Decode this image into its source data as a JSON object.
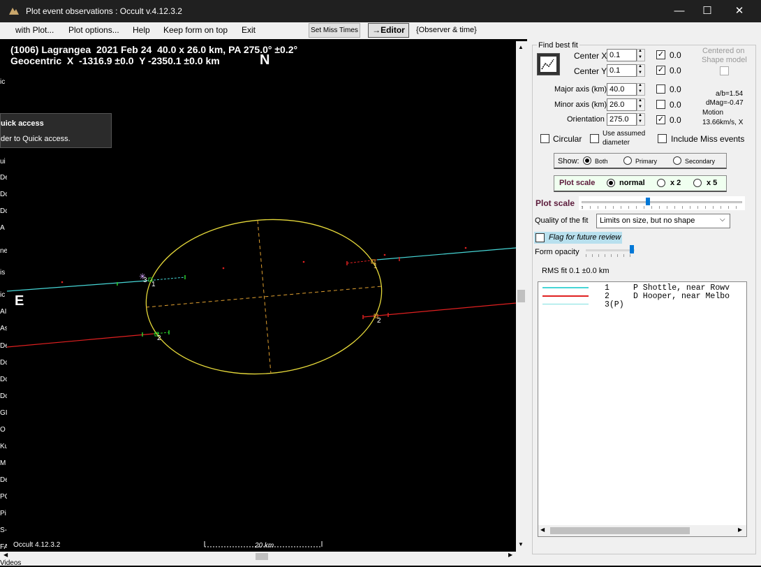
{
  "window": {
    "title": "Plot event observations : Occult v.4.12.3.2",
    "minimize_glyph": "—",
    "maximize_glyph": "☐",
    "close_glyph": "✕"
  },
  "menu": {
    "items": [
      "with Plot...",
      "Plot options...",
      "Help",
      "Keep form on top",
      "Exit"
    ],
    "set_miss_times": "Set Miss Times",
    "editor": "→Editor",
    "observer_time": "{Observer & time}"
  },
  "plot": {
    "header_line1": "(1006) Lagrangea  2021 Feb 24  40.0 x 26.0 km, PA 275.0° ±0.2°",
    "header_line2": "Geocentric  X  -1316.9 ±0.0  Y -2350.1 ±0.0 km",
    "north": "N",
    "east": "E",
    "footer": "Occult 4.12.3.2",
    "scale_label": "20 km",
    "chord_labels": [
      "1",
      "2",
      "3",
      "1",
      "2"
    ],
    "colors": {
      "ellipse": "#e6d93a",
      "chord1": "#46d6d6",
      "chord2": "#e02020",
      "axes": "#e0a030"
    }
  },
  "overlay": {
    "line1": "uick access",
    "line2": "der to Quick access."
  },
  "left_edge_fragments": [
    "ic",
    "ui",
    "De",
    "Dc",
    "Dc",
    "A",
    "ne",
    "is",
    "ic",
    "AI",
    "As",
    "De",
    "Dc",
    "Dc",
    "Dc",
    "GI",
    "O",
    "Ku",
    "M",
    "De",
    "PC",
    "Pi",
    "S-",
    "FA"
  ],
  "taskbar_text": "Videos",
  "panel": {
    "find_best_fit": "Find best fit",
    "center_x_label": "Center X",
    "center_x": "0.1",
    "center_x_unc": "0.0",
    "center_y_label": "Center Y",
    "center_y": "0.1",
    "center_y_unc": "0.0",
    "major_label": "Major axis (km)",
    "major": "40.0",
    "major_unc": "0.0",
    "minor_label": "Minor axis (km)",
    "minor": "26.0",
    "minor_unc": "0.0",
    "orient_label": "Orientation",
    "orient": "275.0",
    "orient_unc": "0.0",
    "centered_on": "Centered on",
    "shape_model": "Shape model",
    "ab": "a/b=1.54",
    "dmag": "dMag=-0.47",
    "motion": "Motion",
    "motion_val": "13.66km/s, X",
    "circular": "Circular",
    "use_assumed": "Use assumed",
    "diameter": "diameter",
    "include_miss": "Include Miss events",
    "show_label": "Show:",
    "show_both": "Both",
    "show_primary": "Primary",
    "show_secondary": "Secondary",
    "plot_scale_label": "Plot scale",
    "scale_normal": "normal",
    "scale_x2": "x 2",
    "scale_x5": "x 5",
    "plot_scale_slider_label": "Plot scale",
    "quality_label": "Quality of the fit",
    "quality_value": "Limits on size, but no shape",
    "flag_review": "Flag for future review",
    "form_opacity": "Form opacity",
    "rms_fit": "RMS fit 0.1 ±0.0 km"
  },
  "legend": [
    {
      "num": "1",
      "text": "P Shottle, near Rowv",
      "color": "#46d6d6"
    },
    {
      "num": "2",
      "text": "D Hooper, near Melbo",
      "color": "#e02020"
    },
    {
      "num": "3(P)",
      "text": "",
      "color": "#7fe0e0"
    }
  ]
}
